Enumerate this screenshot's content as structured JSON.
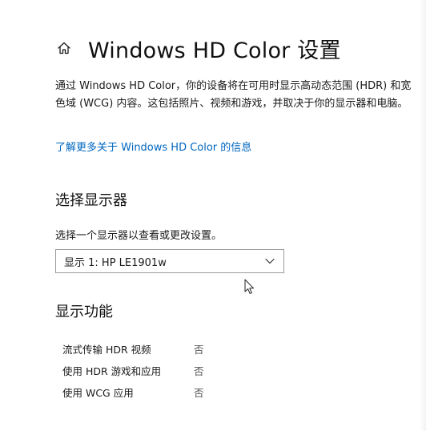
{
  "header": {
    "icon": "home-icon",
    "title": "Windows HD Color 设置"
  },
  "description": "通过 Windows HD Color，你的设备将在可用时显示高动态范围 (HDR) 和宽色域 (WCG) 内容。这包括照片、视频和游戏，并取决于你的显示器和电脑。",
  "learn_more_link": "了解更多关于 Windows HD Color 的信息",
  "select_display": {
    "heading": "选择显示器",
    "label": "选择一个显示器以查看或更改设置。",
    "selected_value": "显示 1: HP LE1901w",
    "icon": "chevron-down-icon"
  },
  "display_features": {
    "heading": "显示功能",
    "rows": [
      {
        "name": "流式传输 HDR 视频",
        "value": "否"
      },
      {
        "name": "使用 HDR 游戏和应用",
        "value": "否"
      },
      {
        "name": "使用 WCG 应用",
        "value": "否"
      }
    ]
  },
  "colors": {
    "link": "#0067c0",
    "text": "#1a1a1a",
    "background": "#ffffff",
    "border": "#9a9a9a"
  }
}
